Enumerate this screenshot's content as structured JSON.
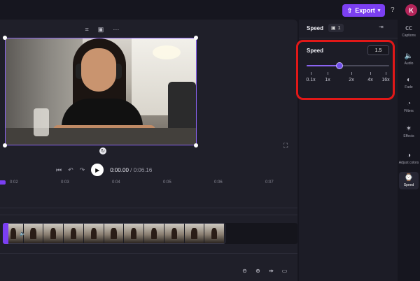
{
  "topbar": {
    "export_label": "Export",
    "export_chevron_icon": "chevron-down-icon",
    "help_label": "?",
    "avatar_initial": "K"
  },
  "preview": {
    "toolbar_icons": [
      "crop-icon",
      "fit-icon",
      "more-icon"
    ],
    "toolbar_glyphs": [
      "⌗",
      "▣",
      "···"
    ]
  },
  "playback": {
    "current_time": "0:00.00",
    "total_time": "/ 0:06.16"
  },
  "timeline": {
    "ruler_labels": [
      "0:02",
      "0:03",
      "0:04",
      "0:05",
      "0:06",
      "0:07"
    ],
    "clip_thumbnail_count": 11
  },
  "panel": {
    "title": "Speed",
    "badge_count": "1",
    "speed": {
      "label": "Speed",
      "value": "1.5",
      "slider_fraction": 0.4,
      "ticks": [
        "0.1x",
        "1x",
        "2x",
        "4x",
        "16x"
      ]
    }
  },
  "rail": [
    {
      "icon": "captions-icon",
      "glyph": "㏄",
      "label": "Captions"
    },
    {
      "icon": "audio-icon",
      "glyph": "🔈",
      "label": "Audio"
    },
    {
      "icon": "fade-icon",
      "glyph": "◐",
      "label": "Fade"
    },
    {
      "icon": "filters-icon",
      "glyph": "◔",
      "label": "Filters"
    },
    {
      "icon": "effects-icon",
      "glyph": "✶",
      "label": "Effects"
    },
    {
      "icon": "adjust-colors-icon",
      "glyph": "◑",
      "label": "Adjust colors"
    },
    {
      "icon": "speed-icon",
      "glyph": "⌚",
      "label": "Speed",
      "active": true
    }
  ],
  "colors": {
    "accent": "#7b3ff2",
    "highlight": "#e11818",
    "avatar": "#b4245a"
  }
}
